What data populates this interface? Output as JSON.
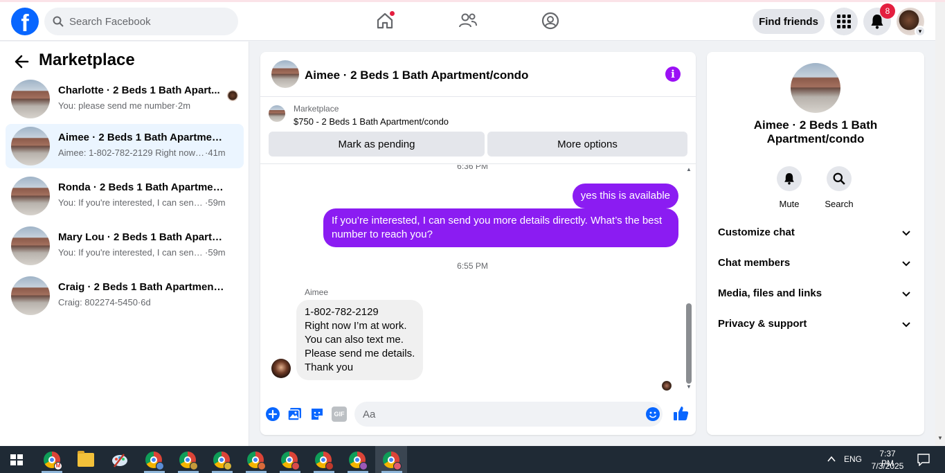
{
  "header": {
    "search_placeholder": "Search Facebook",
    "find_friends_label": "Find friends",
    "notification_count": "8",
    "logo_letter": "f"
  },
  "left": {
    "title": "Marketplace",
    "conversations": [
      {
        "title": "Charlotte · 2 Beds 1 Bath Apart...",
        "snippet": "You: please send me number",
        "time": "2m",
        "active": false
      },
      {
        "title": "Aimee · 2 Beds 1 Bath Apartment/...",
        "snippet": "Aimee: 1-802-782-2129 Right now I'...",
        "time": "41m",
        "active": true
      },
      {
        "title": "Ronda · 2 Beds 1 Bath Apartment/...",
        "snippet": "You: If you're interested, I can send ...",
        "time": "59m",
        "active": false
      },
      {
        "title": "Mary Lou · 2 Beds 1 Bath Apartme...",
        "snippet": "You: If you're interested, I can send ...",
        "time": "59m",
        "active": false
      },
      {
        "title": "Craig · 2 Beds 1 Bath Apartment/c...",
        "snippet": "Craig: 802274-5450",
        "time": "6d",
        "active": false
      }
    ]
  },
  "chat": {
    "title": "Aimee · 2 Beds 1 Bath Apartment/condo",
    "listing_source": "Marketplace",
    "listing_price": "$750 - 2 Beds 1 Bath Apartment/condo",
    "mark_pending_label": "Mark as pending",
    "more_options_label": "More options",
    "time_1": "6:36 PM",
    "out_1": "yes this is available",
    "out_2": "If you’re interested, I can send you more details directly. What’s the best number to reach you?",
    "time_2": "6:55 PM",
    "sender": "Aimee",
    "in_1": "1-802-782-2129\nRight now I’m at work.\nYou can also text me.\nPlease send me details.\nThank you",
    "composer_placeholder": "Aa",
    "gif_label": "GIF"
  },
  "right": {
    "title": "Aimee · 2 Beds 1 Bath Apartment/condo",
    "mute_label": "Mute",
    "search_label": "Search",
    "sections": [
      "Customize chat",
      "Chat members",
      "Media, files and links",
      "Privacy & support"
    ]
  },
  "taskbar": {
    "language": "ENG",
    "time": "7:37 PM",
    "date": "7/3/2025"
  },
  "colors": {
    "brand_blue": "#0866ff",
    "chat_accent": "#8b1cf2",
    "badge_red": "#e41e3f",
    "taskbar": "#1f2a35"
  }
}
